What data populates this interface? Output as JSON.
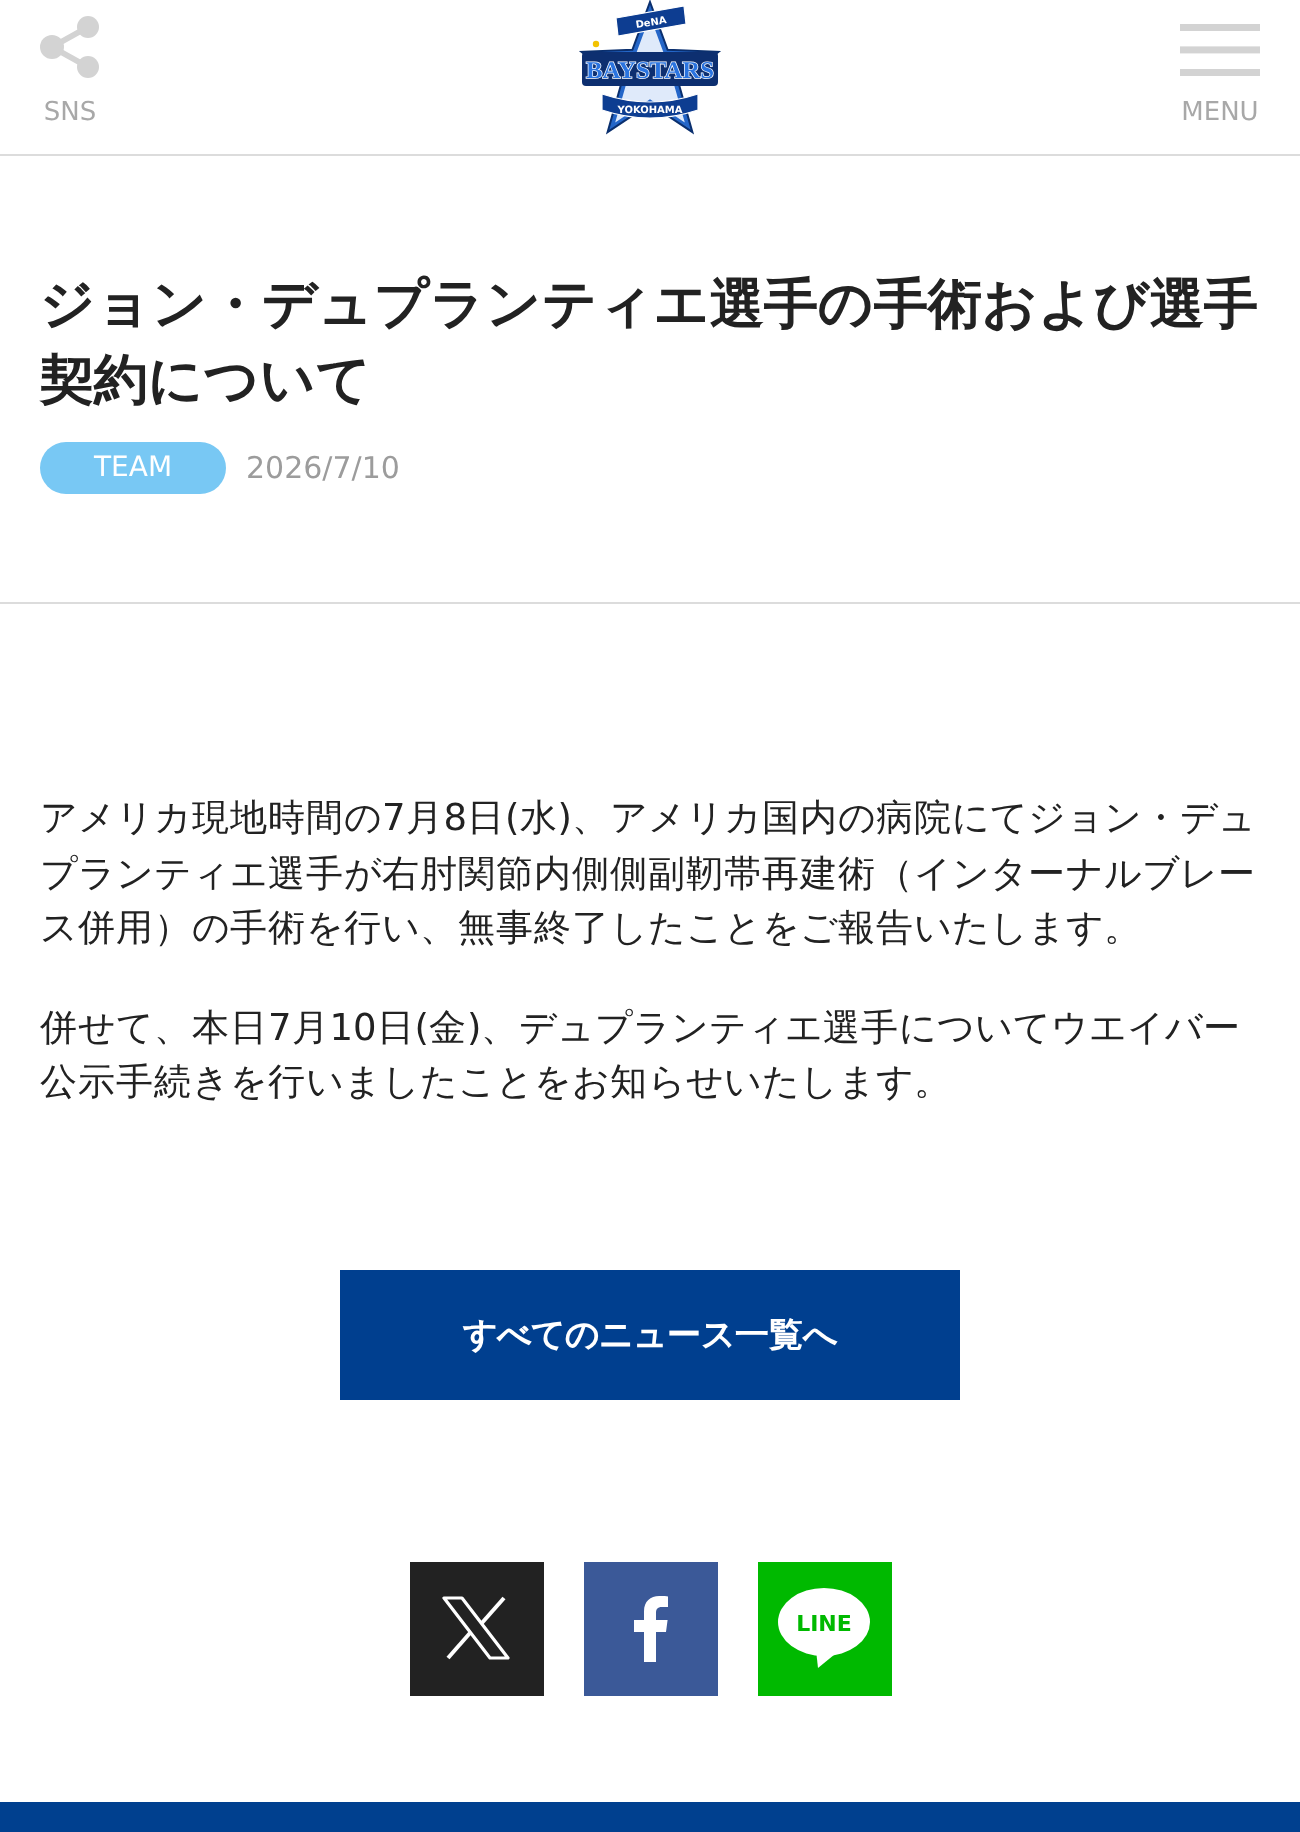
{
  "header": {
    "sns_label": "SNS",
    "logo": {
      "top": "DeNA",
      "main": "BAYSTARS",
      "bottom": "YOKOHAMA"
    },
    "menu_label": "MENU"
  },
  "article": {
    "title": "ジョン・デュプランティエ選手の手術および選手契約について",
    "category": "TEAM",
    "date": "2026/7/10",
    "paragraphs": [
      "アメリカ現地時間の7月8日(水)、アメリカ国内の病院にてジョン・デュプランティエ選手が右肘関節内側側副靭帯再建術（インターナルブレース併用）の手術を行い、無事終了したことをご報告いたします。",
      "併せて、本日7月10日(金)、デュプランティエ選手についてウエイバー公示手続きを行いましたことをお知らせいたします。"
    ]
  },
  "news_button": "すべてのニュース一覧へ",
  "share": [
    {
      "kind": "x"
    },
    {
      "kind": "facebook"
    },
    {
      "kind": "line",
      "label": "LINE"
    }
  ]
}
